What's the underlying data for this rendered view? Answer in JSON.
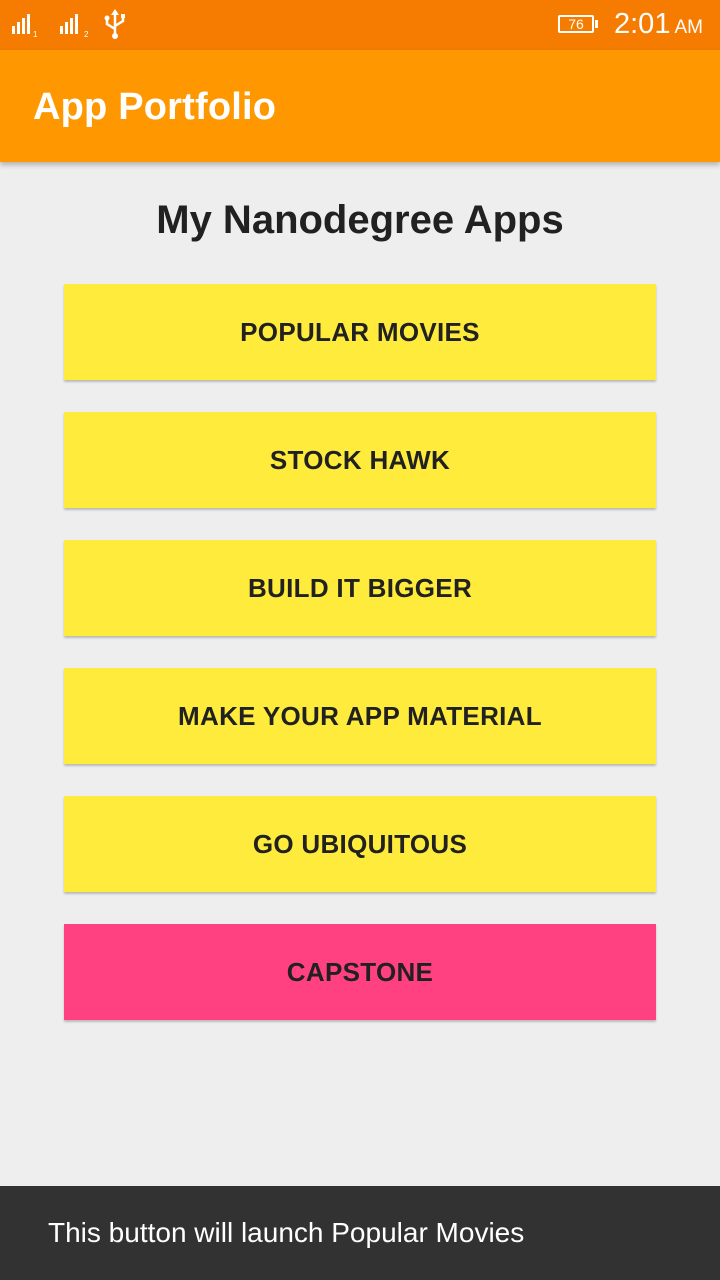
{
  "status_bar": {
    "sim1_label": "1",
    "sim2_label": "2",
    "battery_level": "76",
    "time": "2:01",
    "ampm": "AM"
  },
  "app_bar": {
    "title": "App Portfolio"
  },
  "main": {
    "heading": "My Nanodegree Apps",
    "buttons": [
      {
        "label": "POPULAR MOVIES"
      },
      {
        "label": "STOCK HAWK"
      },
      {
        "label": "BUILD IT BIGGER"
      },
      {
        "label": "MAKE YOUR APP MATERIAL"
      },
      {
        "label": "GO UBIQUITOUS"
      },
      {
        "label": "CAPSTONE"
      }
    ]
  },
  "snackbar": {
    "message": "This button will launch Popular Movies"
  },
  "colors": {
    "status_bar": "#f57c00",
    "primary": "#ff9800",
    "button": "#ffeb3b",
    "accent": "#ff4081",
    "background": "#eeeeee",
    "snackbar": "#323232"
  },
  "icons": [
    "signal-sim1-icon",
    "signal-sim2-icon",
    "usb-icon",
    "battery-icon"
  ]
}
